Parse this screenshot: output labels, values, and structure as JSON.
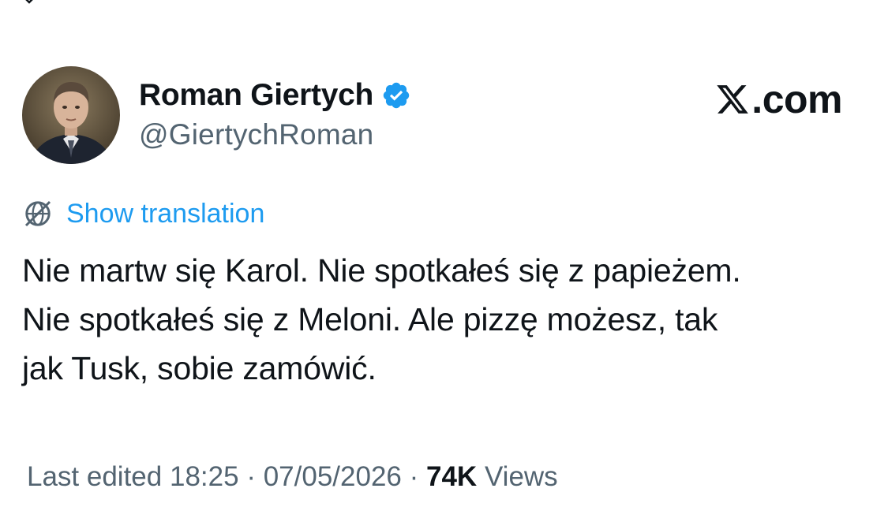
{
  "author": {
    "display_name": "Roman Giertych",
    "handle": "@GiertychRoman",
    "verified": true
  },
  "brand": {
    "label": ".com"
  },
  "translation": {
    "label": "Show translation"
  },
  "tweet": {
    "text": "Nie martw się Karol. Nie spotkałeś się z papieżem.\nNie spotkałeś się z Meloni. Ale pizzę możesz, tak\njak Tusk, sobie zamówić."
  },
  "meta": {
    "edited_prefix": "Last edited",
    "time": "18:25",
    "sep1": "·",
    "date": "07/05/2026",
    "sep2": "·",
    "views_count": "74K",
    "views_label": "Views"
  },
  "colors": {
    "accent": "#1d9bf0",
    "text": "#0f1419",
    "secondary": "#536471",
    "verified_badge": "#1d9bf0"
  },
  "icons": {
    "verified": "verified-badge-icon",
    "translate": "globe-icon",
    "brand": "x-logo-icon",
    "top": "chevron-down-icon"
  }
}
